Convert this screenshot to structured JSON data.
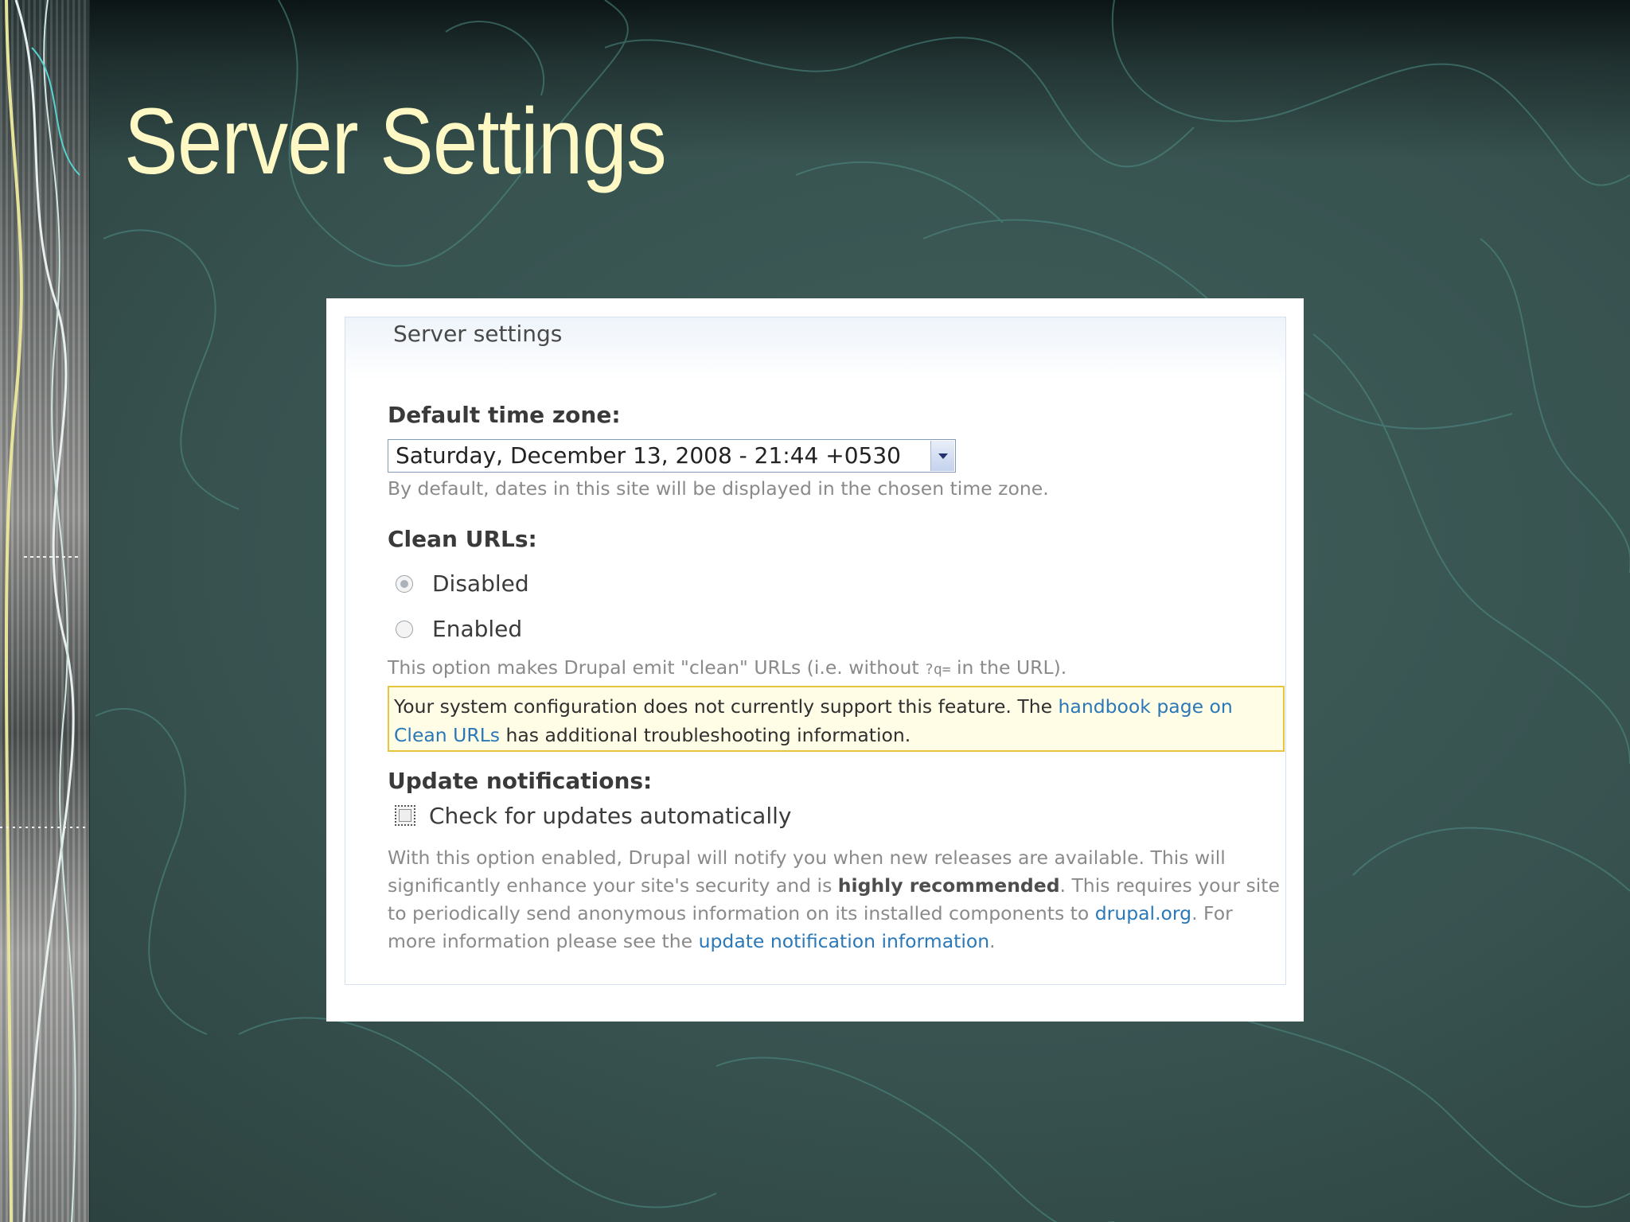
{
  "slide": {
    "title": "Server Settings"
  },
  "fieldset": {
    "legend": "Server settings"
  },
  "timezone": {
    "label": "Default time zone:",
    "selected_value": "Saturday, December 13, 2008 - 21:44 +0530",
    "description": "By default, dates in this site will be displayed in the chosen time zone."
  },
  "clean_urls": {
    "label": "Clean URLs:",
    "options": [
      {
        "label": "Disabled",
        "checked": true
      },
      {
        "label": "Enabled",
        "checked": false
      }
    ],
    "description_before": "This option makes Drupal emit \"clean\" URLs (i.e. without ",
    "description_code": "?q=",
    "description_after": " in the URL).",
    "notice_before": "Your system configuration does not currently support this feature. The ",
    "notice_link": "handbook page on Clean URLs",
    "notice_after": " has additional troubleshooting information."
  },
  "updates": {
    "label": "Update notifications:",
    "checkbox_label": "Check for updates automatically",
    "checkbox_checked": false,
    "desc_part1": "With this option enabled, Drupal will notify you when new releases are available. This will significantly enhance your site's security and is ",
    "desc_bold": "highly recommended",
    "desc_part2": ". This requires your site to periodically send anonymous information on its installed components to ",
    "desc_link1": "drupal.org",
    "desc_part3": ". For more information please see the ",
    "desc_link2": "update notification information",
    "desc_part4": "."
  },
  "colors": {
    "title": "#fdf8c4",
    "link": "#2a78b8",
    "notice_border": "#e7c63e",
    "notice_bg": "#fffde6"
  }
}
